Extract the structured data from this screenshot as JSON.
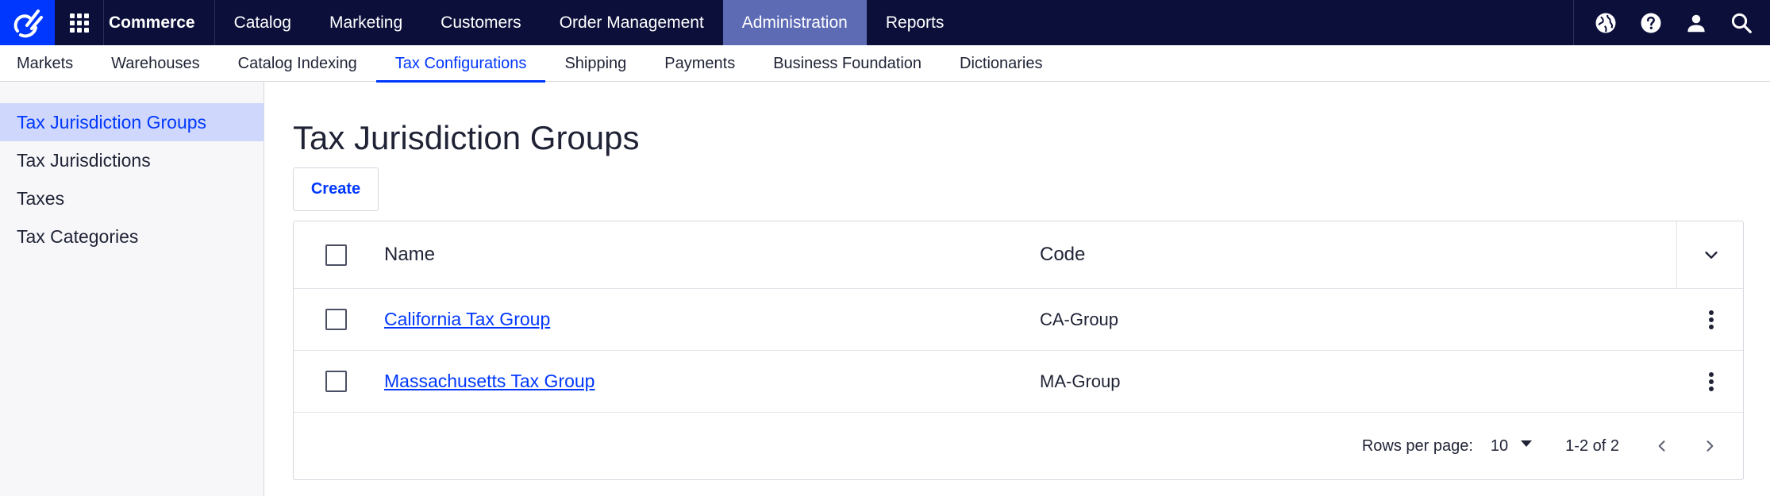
{
  "topbar": {
    "brand": "Commerce",
    "nav": [
      "Catalog",
      "Marketing",
      "Customers",
      "Order Management",
      "Administration",
      "Reports"
    ],
    "active_nav": "Administration",
    "icons": [
      "globe-icon",
      "help-icon",
      "user-icon",
      "search-icon"
    ]
  },
  "subnav": {
    "items": [
      "Markets",
      "Warehouses",
      "Catalog Indexing",
      "Tax Configurations",
      "Shipping",
      "Payments",
      "Business Foundation",
      "Dictionaries"
    ],
    "active": "Tax Configurations"
  },
  "sidebar": {
    "items": [
      "Tax Jurisdiction Groups",
      "Tax Jurisdictions",
      "Taxes",
      "Tax Categories"
    ],
    "active": "Tax Jurisdiction Groups"
  },
  "main": {
    "title": "Tax Jurisdiction Groups",
    "create_label": "Create",
    "table": {
      "columns": [
        "Name",
        "Code"
      ],
      "rows": [
        {
          "name": "California Tax Group",
          "code": "CA-Group"
        },
        {
          "name": "Massachusetts Tax Group",
          "code": "MA-Group"
        }
      ]
    },
    "pager": {
      "rows_per_page_label": "Rows per page:",
      "rows_per_page": "10",
      "range": "1-2 of 2"
    }
  },
  "colors": {
    "topbar_bg": "#0b0f3a",
    "accent": "#0037ff",
    "active_nav_bg": "#5d6bb5",
    "sidebar_active_bg": "#cfd8fc"
  }
}
